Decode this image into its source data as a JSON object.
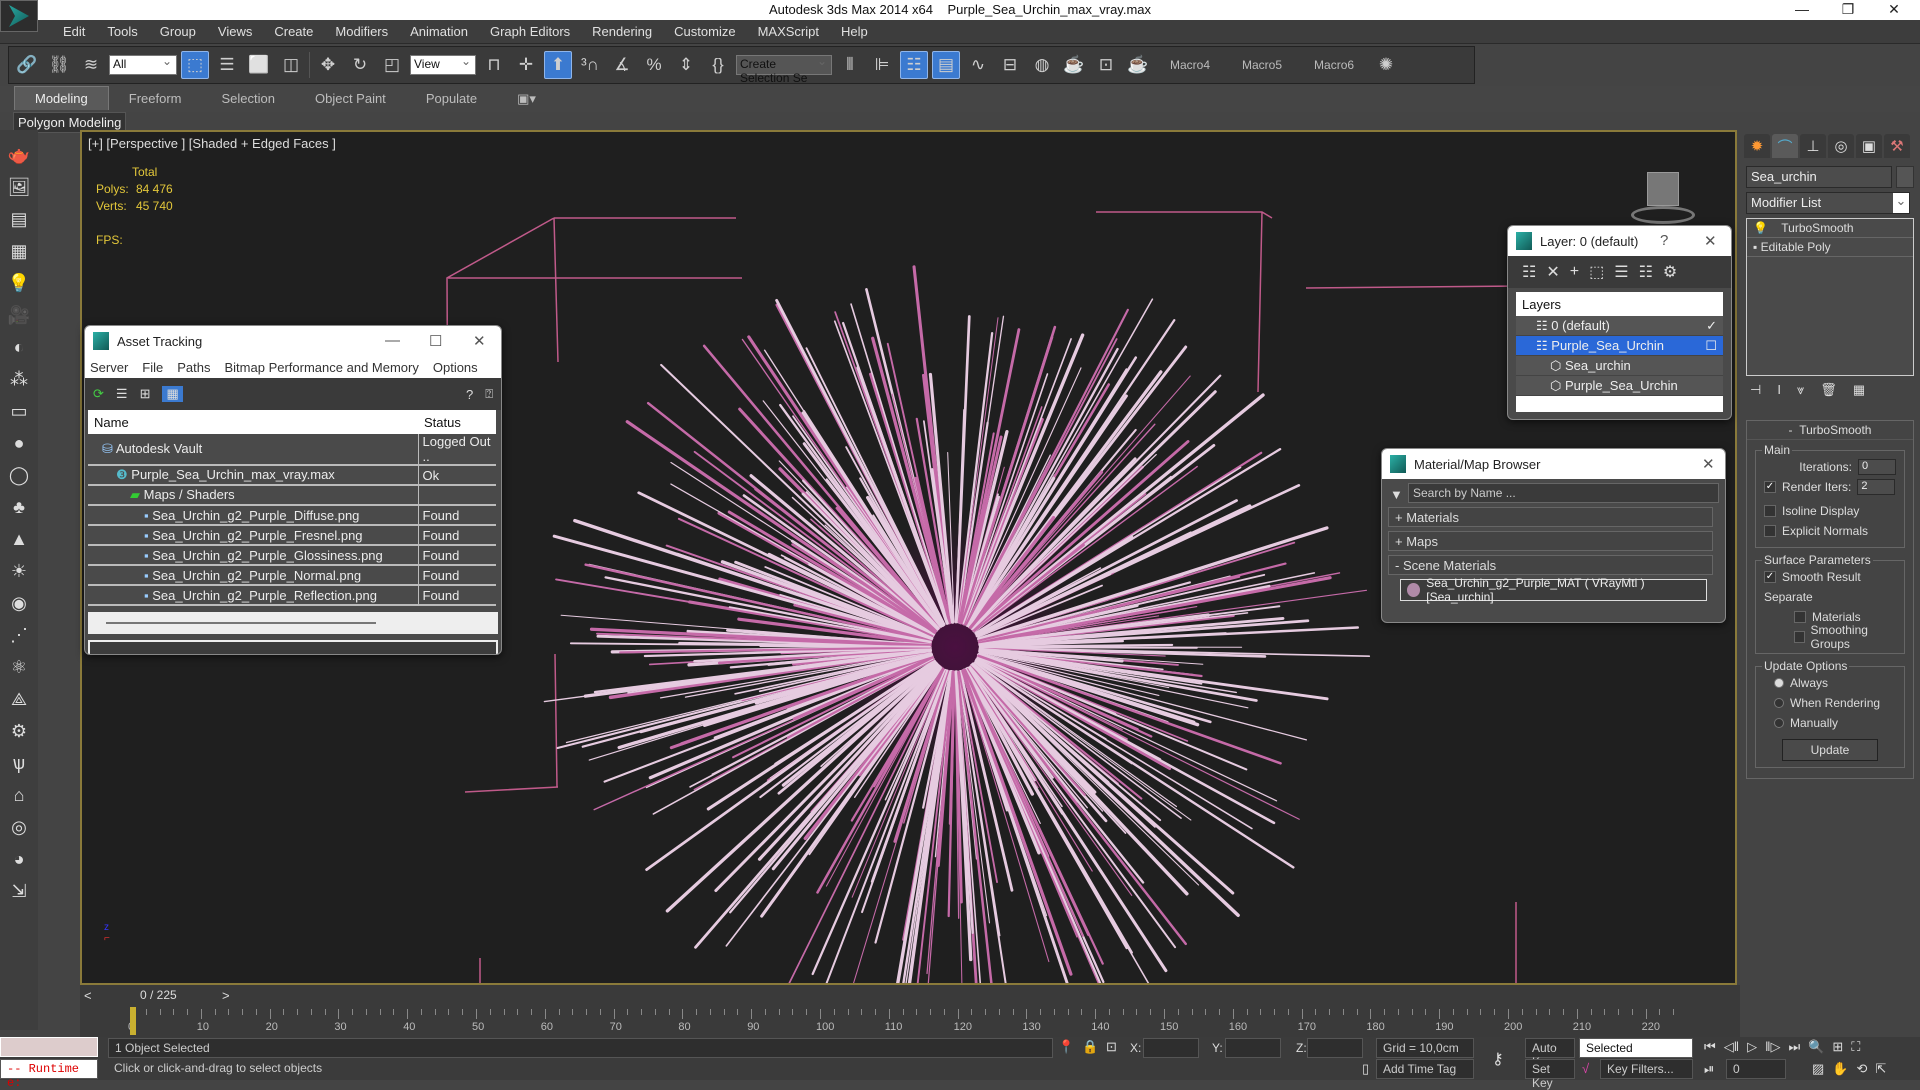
{
  "title": {
    "app": "Autodesk 3ds Max  2014 x64",
    "file": "Purple_Sea_Urchin_max_vray.max",
    "minimize": "—",
    "restore": "❐",
    "close": "✕"
  },
  "menubar": [
    "Edit",
    "Tools",
    "Group",
    "Views",
    "Create",
    "Modifiers",
    "Animation",
    "Graph Editors",
    "Rendering",
    "Customize",
    "MAXScript",
    "Help"
  ],
  "toolbar": {
    "selection_filter": "All",
    "ref_coord": "View",
    "named_selection": "Create Selection Se",
    "macros": [
      "Macro4",
      "Macro5",
      "Macro6"
    ]
  },
  "ribbon": {
    "tabs": [
      "Modeling",
      "Freeform",
      "Selection",
      "Object Paint",
      "Populate"
    ],
    "panel": "Polygon Modeling"
  },
  "viewport": {
    "label": "[+] [Perspective ] [Shaded + Edged Faces ]",
    "stats_header": "Total",
    "polys_label": "Polys:",
    "polys": "84 476",
    "verts_label": "Verts:",
    "verts": "45 740",
    "fps_label": "FPS:"
  },
  "asset_tracking": {
    "title": "Asset Tracking",
    "menu": [
      "Server",
      "File",
      "Paths",
      "Bitmap Performance and Memory",
      "Options"
    ],
    "columns": [
      "Name",
      "Status"
    ],
    "rows": [
      {
        "name": "Autodesk Vault",
        "status": "Logged Out ..",
        "level": 1
      },
      {
        "name": "Purple_Sea_Urchin_max_vray.max",
        "status": "Ok",
        "level": 2
      },
      {
        "name": "Maps / Shaders",
        "status": "",
        "level": 3
      },
      {
        "name": "Sea_Urchin_g2_Purple_Diffuse.png",
        "status": "Found",
        "level": 4
      },
      {
        "name": "Sea_Urchin_g2_Purple_Fresnel.png",
        "status": "Found",
        "level": 4
      },
      {
        "name": "Sea_Urchin_g2_Purple_Glossiness.png",
        "status": "Found",
        "level": 4
      },
      {
        "name": "Sea_Urchin_g2_Purple_Normal.png",
        "status": "Found",
        "level": 4
      },
      {
        "name": "Sea_Urchin_g2_Purple_Reflection.png",
        "status": "Found",
        "level": 4
      }
    ]
  },
  "layer_dialog": {
    "title": "Layer: 0 (default)",
    "help": "?",
    "header": "Layers",
    "rows": [
      {
        "name": "0 (default)",
        "state": "✓"
      },
      {
        "name": "Purple_Sea_Urchin",
        "state": "☐"
      },
      {
        "name": "Sea_urchin",
        "state": ""
      },
      {
        "name": "Purple_Sea_Urchin",
        "state": ""
      }
    ]
  },
  "material_browser": {
    "title": "Material/Map Browser",
    "search_placeholder": "Search by Name ...",
    "groups": [
      "+ Materials",
      "+ Maps",
      "- Scene Materials"
    ],
    "item": "Sea_Urchin_g2_Purple_MAT ( VRayMtl ) [Sea_urchin]"
  },
  "command_panel": {
    "object_name": "Sea_urchin",
    "modifier_list": "Modifier List",
    "stack": [
      "TurboSmooth",
      "Editable Poly"
    ],
    "rollout": "TurboSmooth",
    "main_label": "Main",
    "iterations_label": "Iterations:",
    "iterations": "0",
    "render_iters_label": "Render Iters:",
    "render_iters": "2",
    "isoline": "Isoline Display",
    "explicit_normals": "Explicit Normals",
    "surface_label": "Surface Parameters",
    "smooth_result": "Smooth Result",
    "separate": "Separate",
    "materials": "Materials",
    "smoothing_groups": "Smoothing Groups",
    "update_label": "Update Options",
    "always": "Always",
    "when_rendering": "When Rendering",
    "manually": "Manually",
    "update_button": "Update"
  },
  "timeline": {
    "frame": "0 / 225",
    "ticks": [
      "0",
      "10",
      "20",
      "30",
      "40",
      "50",
      "60",
      "70",
      "80",
      "90",
      "100",
      "110",
      "120",
      "130",
      "140",
      "150",
      "160",
      "170",
      "180",
      "190",
      "200",
      "210",
      "220"
    ]
  },
  "status": {
    "selected": "1 Object Selected",
    "prompt": "Click or click-and-drag to select objects",
    "script": "-- Runtime e:",
    "x": "X:",
    "y": "Y:",
    "z": "Z:",
    "grid": "Grid = 10,0cm",
    "add_time_tag": "Add Time Tag",
    "auto_key": "Auto Key",
    "set_key": "Set Key",
    "key_mode": "Selected",
    "key_filters": "Key Filters...",
    "current_frame": "0"
  }
}
